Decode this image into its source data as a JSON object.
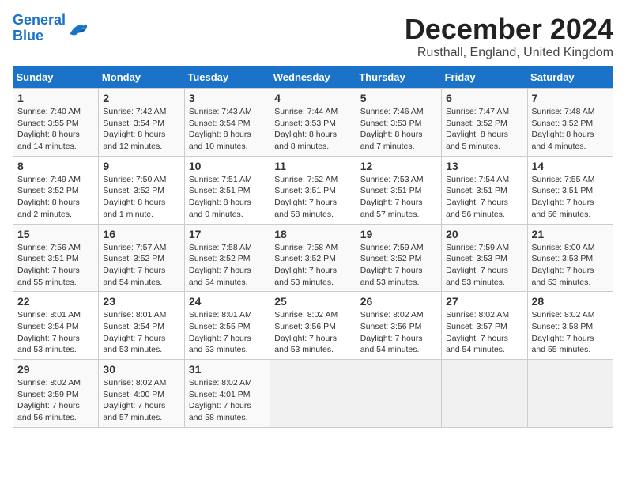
{
  "logo": {
    "line1": "General",
    "line2": "Blue"
  },
  "title": "December 2024",
  "location": "Rusthall, England, United Kingdom",
  "days_of_week": [
    "Sunday",
    "Monday",
    "Tuesday",
    "Wednesday",
    "Thursday",
    "Friday",
    "Saturday"
  ],
  "weeks": [
    [
      {
        "day": 1,
        "sunrise": "7:40 AM",
        "sunset": "3:55 PM",
        "daylight": "8 hours and 14 minutes."
      },
      {
        "day": 2,
        "sunrise": "7:42 AM",
        "sunset": "3:54 PM",
        "daylight": "8 hours and 12 minutes."
      },
      {
        "day": 3,
        "sunrise": "7:43 AM",
        "sunset": "3:54 PM",
        "daylight": "8 hours and 10 minutes."
      },
      {
        "day": 4,
        "sunrise": "7:44 AM",
        "sunset": "3:53 PM",
        "daylight": "8 hours and 8 minutes."
      },
      {
        "day": 5,
        "sunrise": "7:46 AM",
        "sunset": "3:53 PM",
        "daylight": "8 hours and 7 minutes."
      },
      {
        "day": 6,
        "sunrise": "7:47 AM",
        "sunset": "3:52 PM",
        "daylight": "8 hours and 5 minutes."
      },
      {
        "day": 7,
        "sunrise": "7:48 AM",
        "sunset": "3:52 PM",
        "daylight": "8 hours and 4 minutes."
      }
    ],
    [
      {
        "day": 8,
        "sunrise": "7:49 AM",
        "sunset": "3:52 PM",
        "daylight": "8 hours and 2 minutes."
      },
      {
        "day": 9,
        "sunrise": "7:50 AM",
        "sunset": "3:52 PM",
        "daylight": "8 hours and 1 minute."
      },
      {
        "day": 10,
        "sunrise": "7:51 AM",
        "sunset": "3:51 PM",
        "daylight": "8 hours and 0 minutes."
      },
      {
        "day": 11,
        "sunrise": "7:52 AM",
        "sunset": "3:51 PM",
        "daylight": "7 hours and 58 minutes."
      },
      {
        "day": 12,
        "sunrise": "7:53 AM",
        "sunset": "3:51 PM",
        "daylight": "7 hours and 57 minutes."
      },
      {
        "day": 13,
        "sunrise": "7:54 AM",
        "sunset": "3:51 PM",
        "daylight": "7 hours and 56 minutes."
      },
      {
        "day": 14,
        "sunrise": "7:55 AM",
        "sunset": "3:51 PM",
        "daylight": "7 hours and 56 minutes."
      }
    ],
    [
      {
        "day": 15,
        "sunrise": "7:56 AM",
        "sunset": "3:51 PM",
        "daylight": "7 hours and 55 minutes."
      },
      {
        "day": 16,
        "sunrise": "7:57 AM",
        "sunset": "3:52 PM",
        "daylight": "7 hours and 54 minutes."
      },
      {
        "day": 17,
        "sunrise": "7:58 AM",
        "sunset": "3:52 PM",
        "daylight": "7 hours and 54 minutes."
      },
      {
        "day": 18,
        "sunrise": "7:58 AM",
        "sunset": "3:52 PM",
        "daylight": "7 hours and 53 minutes."
      },
      {
        "day": 19,
        "sunrise": "7:59 AM",
        "sunset": "3:52 PM",
        "daylight": "7 hours and 53 minutes."
      },
      {
        "day": 20,
        "sunrise": "7:59 AM",
        "sunset": "3:53 PM",
        "daylight": "7 hours and 53 minutes."
      },
      {
        "day": 21,
        "sunrise": "8:00 AM",
        "sunset": "3:53 PM",
        "daylight": "7 hours and 53 minutes."
      }
    ],
    [
      {
        "day": 22,
        "sunrise": "8:01 AM",
        "sunset": "3:54 PM",
        "daylight": "7 hours and 53 minutes."
      },
      {
        "day": 23,
        "sunrise": "8:01 AM",
        "sunset": "3:54 PM",
        "daylight": "7 hours and 53 minutes."
      },
      {
        "day": 24,
        "sunrise": "8:01 AM",
        "sunset": "3:55 PM",
        "daylight": "7 hours and 53 minutes."
      },
      {
        "day": 25,
        "sunrise": "8:02 AM",
        "sunset": "3:56 PM",
        "daylight": "7 hours and 53 minutes."
      },
      {
        "day": 26,
        "sunrise": "8:02 AM",
        "sunset": "3:56 PM",
        "daylight": "7 hours and 54 minutes."
      },
      {
        "day": 27,
        "sunrise": "8:02 AM",
        "sunset": "3:57 PM",
        "daylight": "7 hours and 54 minutes."
      },
      {
        "day": 28,
        "sunrise": "8:02 AM",
        "sunset": "3:58 PM",
        "daylight": "7 hours and 55 minutes."
      }
    ],
    [
      {
        "day": 29,
        "sunrise": "8:02 AM",
        "sunset": "3:59 PM",
        "daylight": "7 hours and 56 minutes."
      },
      {
        "day": 30,
        "sunrise": "8:02 AM",
        "sunset": "4:00 PM",
        "daylight": "7 hours and 57 minutes."
      },
      {
        "day": 31,
        "sunrise": "8:02 AM",
        "sunset": "4:01 PM",
        "daylight": "7 hours and 58 minutes."
      },
      null,
      null,
      null,
      null
    ]
  ]
}
